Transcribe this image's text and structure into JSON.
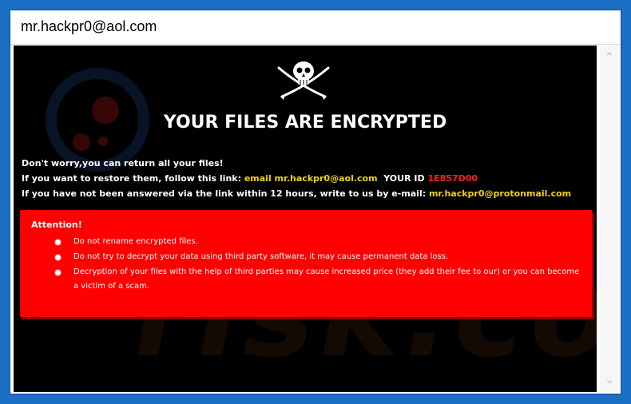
{
  "window": {
    "title": "mr.hackpr0@aol.com"
  },
  "note": {
    "headline": "YOUR FILES ARE ENCRYPTED",
    "line1": "Don't worry,you can return all your files!",
    "line2_prefix": "If you want to restore them, follow this link: ",
    "line2_email": "email mr.hackpr0@aol.com",
    "line2_id_label": "YOUR ID ",
    "line2_id": "1E857D00",
    "line3_prefix": "If you have not been answered via the link within 12 hours, write to us by e-mail: ",
    "line3_email": "mr.hackpr0@protonmail.com"
  },
  "attention": {
    "title": "Attention!",
    "items": [
      "Do not rename encrypted files.",
      "Do not try to decrypt your data using third party software, it may cause permanent data loss.",
      "Decryption of your files with the help of third parties may cause increased price (they add their fee to our) or you can become a victim of a scam."
    ]
  },
  "watermark": {
    "text": "risk.com"
  },
  "icons": {
    "logo": "skull-crossbones-icon",
    "scroll_up": "chevron-up-icon",
    "scroll_down": "chevron-down-icon",
    "bullet": "bullet-dot-icon"
  },
  "colors": {
    "content_bg": "#000000",
    "attention_bg": "#ff0000",
    "highlight_yellow": "#f2d200",
    "id_red": "#ff2020",
    "desktop_bg": "#1a6fc4"
  }
}
